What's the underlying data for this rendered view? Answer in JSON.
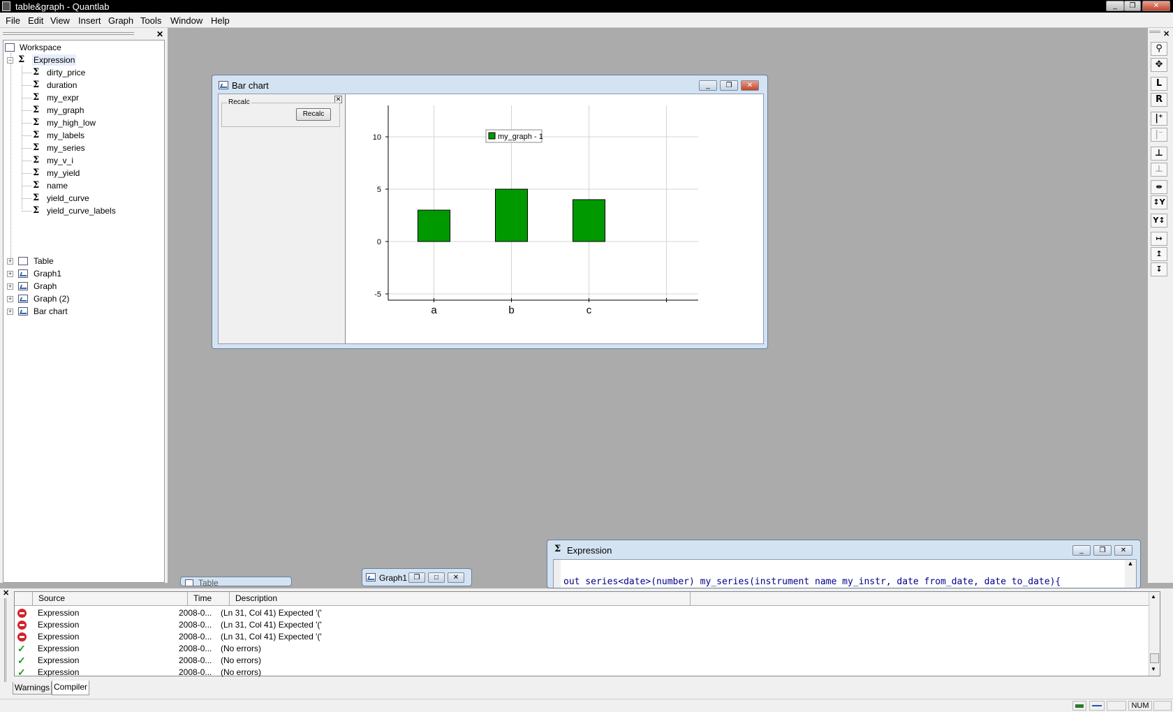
{
  "window": {
    "title": "table&graph - Quantlab"
  },
  "menu": [
    "File",
    "Edit",
    "View",
    "Insert",
    "Graph",
    "Tools",
    "Window",
    "Help"
  ],
  "workspace": {
    "root": "Workspace",
    "expression_folder": "Expression",
    "expressions": [
      "dirty_price",
      "duration",
      "my_expr",
      "my_graph",
      "my_high_low",
      "my_labels",
      "my_series",
      "my_v_i",
      "my_yield",
      "name",
      "yield_curve",
      "yield_curve_labels"
    ],
    "folders": [
      "Table",
      "Graph1",
      "Graph",
      "Graph (2)",
      "Bar chart"
    ]
  },
  "right_toolbar": [
    "magnifier-icon",
    "move-icon",
    "L",
    "R",
    "axis-left-icon",
    "axis-left-dim-icon",
    "axis-bottom-icon",
    "axis-bottom-dim-icon",
    "scale-x-icon",
    "scale-y-icon",
    "y-move-icon",
    "x-range-icon",
    "y-range-icon",
    "y-range2-icon"
  ],
  "barchart_window": {
    "title": "Bar chart",
    "group_label": "Recalc",
    "button": "Recalc"
  },
  "chart_data": {
    "type": "bar",
    "categories": [
      "a",
      "b",
      "c"
    ],
    "series": [
      {
        "name": "my_graph - 1",
        "values": [
          3,
          5,
          4
        ],
        "color": "#009a00"
      }
    ],
    "yticks": [
      -5,
      0,
      5,
      10
    ],
    "ylim": [
      -5.6,
      13
    ],
    "xslots": 4,
    "legend": "my_graph - 1",
    "grid": true
  },
  "expression_window": {
    "title": "Expression",
    "code": "out series<date>(number) my_series(instrument name my_instr, date from_date, date to_date){"
  },
  "minimized": {
    "table": "Table",
    "graph1": "Graph1"
  },
  "error_list": {
    "headers": [
      "Source",
      "Time",
      "Description"
    ],
    "rows": [
      {
        "status": "error",
        "source": "Expression",
        "time": "2008-0...",
        "desc": "(Ln 31, Col 41) Expected '('"
      },
      {
        "status": "error",
        "source": "Expression",
        "time": "2008-0...",
        "desc": "(Ln 31, Col 41) Expected '('"
      },
      {
        "status": "error",
        "source": "Expression",
        "time": "2008-0...",
        "desc": "(Ln 31, Col 41) Expected '('"
      },
      {
        "status": "ok",
        "source": "Expression",
        "time": "2008-0...",
        "desc": "(No errors)"
      },
      {
        "status": "ok",
        "source": "Expression",
        "time": "2008-0...",
        "desc": "(No errors)"
      },
      {
        "status": "ok",
        "source": "Expression",
        "time": "2008-0...",
        "desc": "(No errors)"
      }
    ]
  },
  "tabs": [
    "Warnings",
    "Compiler"
  ],
  "status": {
    "num": "NUM"
  }
}
